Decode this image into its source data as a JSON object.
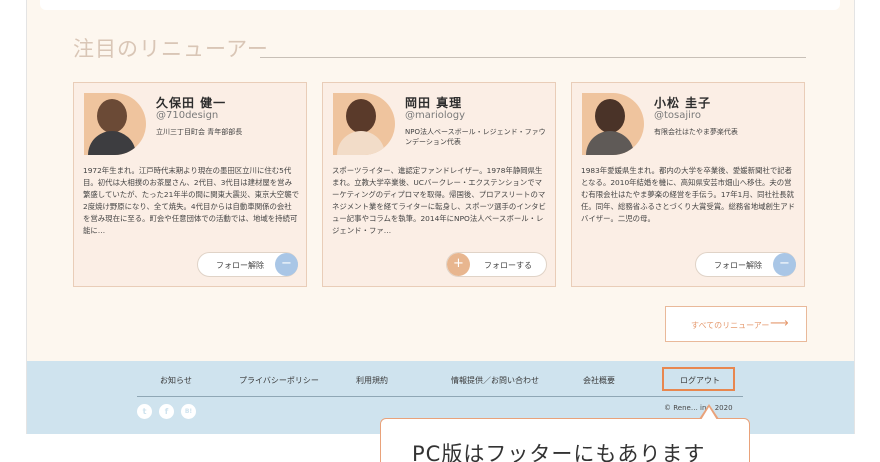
{
  "section": {
    "title": "注目のリニューアー"
  },
  "cards": [
    {
      "name": "久保田 健一",
      "handle": "@710design",
      "role": "立川三丁目町会 青年部部長",
      "bio": "1972年生まれ。江戸時代末期より現在の墨田区立川に住む5代目。初代は大相撲のお茶屋さん、2代目、3代目は建材屋を営み繁盛していたが、たった21年半の間に関東大震災、東京大空襲で2度焼け野原になり、全て焼失。4代目からは自動車関係の会社を営み現在に至る。町会や任意団体での活動では、地域を持続可能に…",
      "follow_label": "フォロー解除",
      "follow_icon": "minus-icon",
      "follow_color": "#a9c6e6"
    },
    {
      "name": "岡田 真理",
      "handle": "@mariology",
      "role": "NPO法人ベースボール・レジェンド・ファウンデーション代表",
      "bio": "スポーツライター、進認定ファンドレイザー。1978年静岡県生まれ。立教大学卒業後、UCバークレー・エクステンションでマーケティングのディプロマを取得。帰国後、プロアスリートのマネジメント業を経てライターに転身し、スポーツ選手のインタビュー記事やコラムを執筆。2014年にNPO法人ベースボール・レジェンド・ファ…",
      "follow_label": "フォローする",
      "follow_icon": "plus-icon",
      "follow_color": "#e8b68f"
    },
    {
      "name": "小松 圭子",
      "handle": "@tosajiro",
      "role": "有限会社はたやま夢楽代表",
      "bio": "1983年愛媛県生まれ。都内の大学を卒業後、愛媛新聞社で記者となる。2010年結婚を機に、高知県安芸市畑山へ移住。夫の営む有限会社はたやま夢楽の経営を手伝う。17年1月、同社社長就任。同年、総務省ふるさとづくり大賞受賞。総務省地域創生アドバイザー。二児の母。",
      "follow_label": "フォロー解除",
      "follow_icon": "minus-icon",
      "follow_color": "#a9c6e6"
    }
  ],
  "all_button": {
    "label": "すべてのリニューアー",
    "icon": "arrow-right-icon"
  },
  "footer": {
    "nav": [
      "お知らせ",
      "プライバシーポリシー",
      "利用規約",
      "情報提供／お問い合わせ",
      "会社概要",
      "ログアウト"
    ],
    "social": [
      {
        "icon": "twitter-icon",
        "glyph": "t"
      },
      {
        "icon": "facebook-icon",
        "glyph": "f"
      },
      {
        "icon": "hatena-bookmark-icon",
        "glyph": "B!"
      }
    ],
    "copyright": "© Rene… inc. 2020"
  },
  "callout": {
    "text": "PC版はフッターにもあります"
  },
  "colors": {
    "accent": "#e8874f",
    "footer_bg": "#cfe3ee",
    "card_bg": "#fbeee5"
  }
}
